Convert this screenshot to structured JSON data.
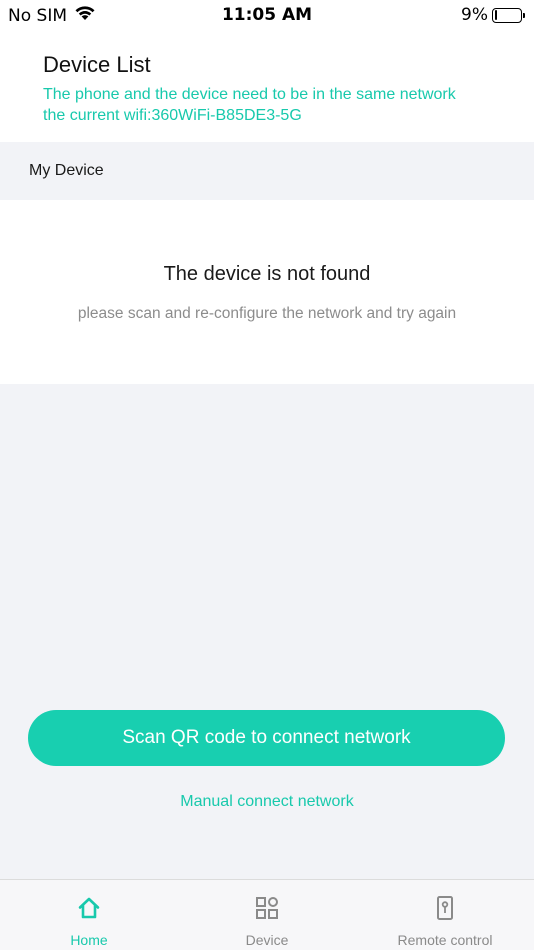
{
  "status_bar": {
    "carrier": "No SIM",
    "time": "11:05 AM",
    "battery": "9%",
    "battery_level": 0.09
  },
  "header": {
    "title": "Device List",
    "hint_line1": "The phone and the device need to be in the same network",
    "hint_line2": "the current wifi:360WiFi-B85DE3-5G"
  },
  "section": {
    "title": "My Device"
  },
  "empty_state": {
    "title": "The device is not found",
    "subtitle": "please scan and re-configure the network and try again"
  },
  "actions": {
    "scan_label": "Scan QR code to connect network",
    "manual_label": "Manual connect network"
  },
  "tabs": [
    {
      "label": "Home",
      "icon": "home-icon",
      "active": true
    },
    {
      "label": "Device",
      "icon": "grid-icon",
      "active": false
    },
    {
      "label": "Remote control",
      "icon": "remote-icon",
      "active": false
    }
  ],
  "colors": {
    "accent": "#18c9ac",
    "button": "#18cfb0",
    "background": "#f2f3f7",
    "inactive": "#8a8a8a"
  }
}
